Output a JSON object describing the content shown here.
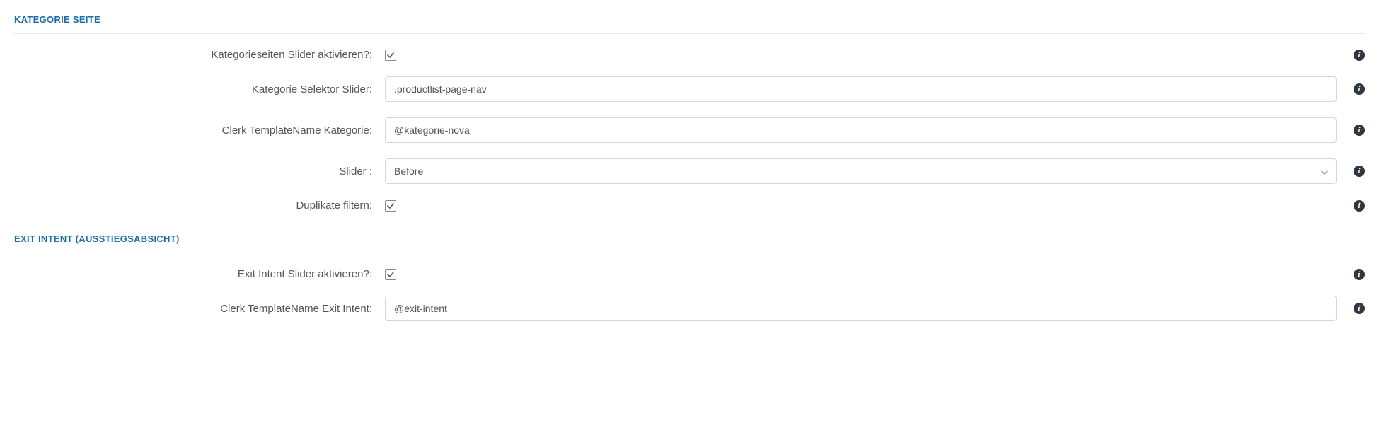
{
  "sections": {
    "kategorie": {
      "title": "KATEGORIE SEITE",
      "rows": {
        "activate": {
          "label": "Kategorieseiten Slider aktivieren?:"
        },
        "selector": {
          "label": "Kategorie Selektor Slider:",
          "value": ".productlist-page-nav"
        },
        "template": {
          "label": "Clerk TemplateName Kategorie:",
          "value": "@kategorie-nova"
        },
        "slider": {
          "label": "Slider :",
          "value": "Before"
        },
        "dedupe": {
          "label": "Duplikate filtern:"
        }
      }
    },
    "exit": {
      "title": "EXIT INTENT (AUSSTIEGSABSICHT)",
      "rows": {
        "activate": {
          "label": "Exit Intent Slider aktivieren?:"
        },
        "template": {
          "label": "Clerk TemplateName Exit Intent:",
          "value": "@exit-intent"
        }
      }
    }
  },
  "info_glyph": "i"
}
